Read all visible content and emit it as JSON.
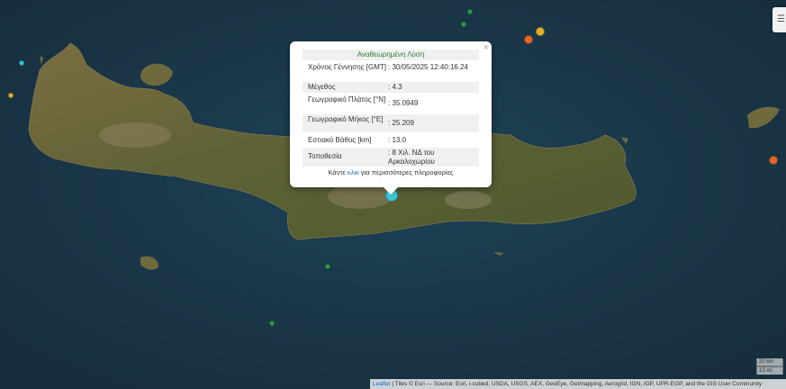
{
  "popup": {
    "title": "Αναθεωρημένη Λύση",
    "close_symbol": "×",
    "rows": [
      {
        "label": "Χρόνος Γέννησης [GMT]",
        "value": ": 30/05/2025 12:40:16.24"
      },
      {
        "label": "Μέγεθος",
        "value": ": 4.3"
      },
      {
        "label": "Γεωγραφικό Πλάτος [°N]",
        "value": ": 35.0949"
      },
      {
        "label": "Γεωγραφικό Μήκος [°E]",
        "value": ": 25.209"
      },
      {
        "label": "Εστιακό Βάθος [km]",
        "value": ": 13.0"
      },
      {
        "label": "Τοποθεσία",
        "value": ": 8 Χιλ. ΝΔ του Αρκαλοχωρίου"
      }
    ],
    "footer_pre": "Κάντε ",
    "footer_link": "κλικ",
    "footer_post": " για περισσότερες πληροφορίες"
  },
  "scale": {
    "top_label": "20 km",
    "bottom_label": "10 mi"
  },
  "attribution": {
    "leaflet_label": "Leaflet",
    "text": " | Tiles © Esri — Source: Esri, i-cubed, USDA, USGS, AEX, GeoEye, Getmapping, Aerogrid, IGN, IGP, UPR-EGP, and the GIS User Community"
  },
  "colors": {
    "sea": "#1d3b4e",
    "land": "#6b6a3c",
    "green_event": "#2e9e4a",
    "orange_event": "#e2672a",
    "yellow_event": "#e8b12c",
    "cyan_event": "#3fc4d6"
  },
  "widget_icon": "layers-icon"
}
